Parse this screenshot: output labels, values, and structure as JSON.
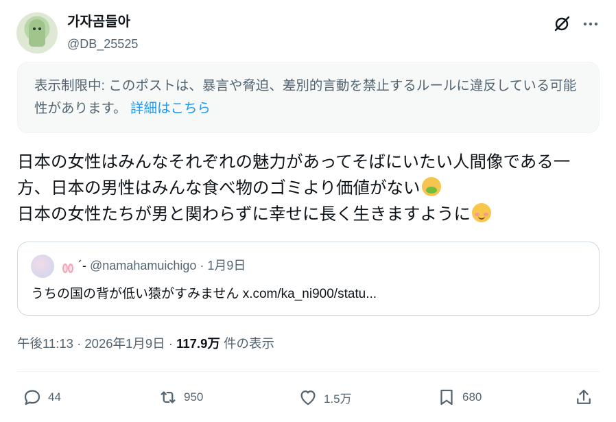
{
  "author": {
    "display_name": "가자곰들아",
    "handle": "@DB_25525"
  },
  "notice": {
    "text": "表示制限中: このポストは、暴言や脅迫、差別的言動を禁止するルールに違反している可能性があります。",
    "link": "詳細はこちら"
  },
  "tweet": {
    "line1": "日本の女性はみんなそれぞれの魅力があってそばにいたい人間像である一",
    "line2": "方、日本の男性はみんな食べ物のゴミより価値がない",
    "line3": "日本の女性たちが男と関わらずに幸せに長く生きますように"
  },
  "quote": {
    "name_glyph": "´-",
    "handle": "@namahamuichigo",
    "separator": "·",
    "date": "1月9日",
    "text": "うちの国の背が低い猿がすみません x.com/ka_ni900/statu..."
  },
  "meta": {
    "time": "午後11:13",
    "date": "2026年1月9日",
    "sep": "·",
    "views": "117.9万",
    "views_label": "件の表示"
  },
  "actions": {
    "replies": "44",
    "reposts": "950",
    "likes": "1.5万",
    "bookmarks": "680"
  },
  "icons": [
    "grok-icon",
    "more-icon",
    "reply-icon",
    "repost-icon",
    "like-icon",
    "bookmark-icon",
    "share-icon"
  ]
}
